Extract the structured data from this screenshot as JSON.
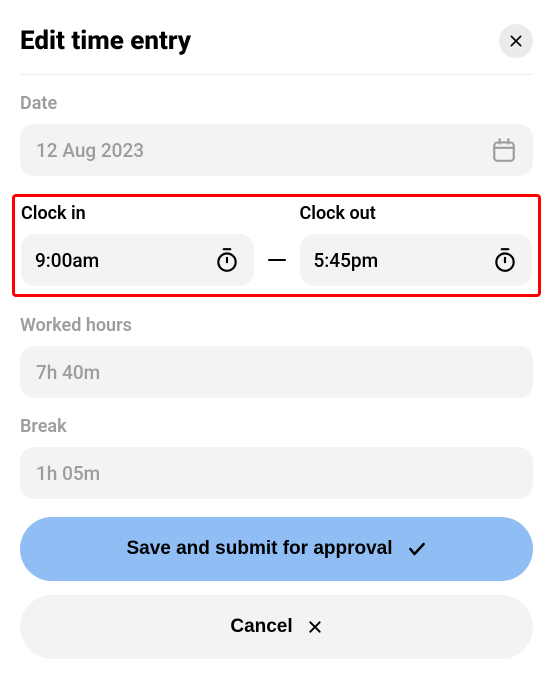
{
  "header": {
    "title": "Edit time entry"
  },
  "date": {
    "label": "Date",
    "value": "12 Aug 2023"
  },
  "clockIn": {
    "label": "Clock in",
    "value": "9:00am"
  },
  "clockOut": {
    "label": "Clock out",
    "value": "5:45pm"
  },
  "workedHours": {
    "label": "Worked hours",
    "value": "7h 40m"
  },
  "break": {
    "label": "Break",
    "value": "1h 05m"
  },
  "buttons": {
    "save": "Save and submit for approval",
    "cancel": "Cancel"
  }
}
